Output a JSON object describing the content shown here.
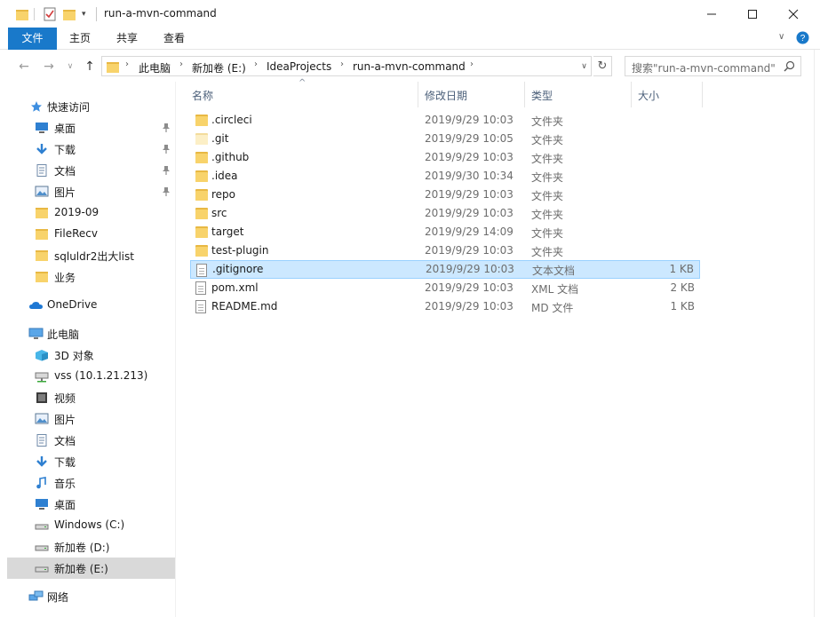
{
  "window": {
    "title": "run-a-mvn-command",
    "minimize_icon": "minimize-icon",
    "maximize_icon": "maximize-icon",
    "close_icon": "close-icon"
  },
  "ribbon": {
    "tabs": [
      "文件",
      "主页",
      "共享",
      "查看"
    ]
  },
  "address": {
    "breadcrumbs": [
      "此电脑",
      "新加卷 (E:)",
      "IdeaProjects",
      "run-a-mvn-command"
    ],
    "search_placeholder": "搜索\"run-a-mvn-command\""
  },
  "nav": {
    "quick_access": "快速访问",
    "quick_items": [
      {
        "label": "桌面",
        "icon": "desktop-icon",
        "pinned": true
      },
      {
        "label": "下载",
        "icon": "download-icon",
        "pinned": true
      },
      {
        "label": "文档",
        "icon": "document-icon",
        "pinned": true
      },
      {
        "label": "图片",
        "icon": "picture-icon",
        "pinned": true
      },
      {
        "label": "2019-09",
        "icon": "folder-icon",
        "pinned": false
      },
      {
        "label": "FileRecv",
        "icon": "folder-icon",
        "pinned": false
      },
      {
        "label": "sqluldr2出大list",
        "icon": "folder-icon",
        "pinned": false
      },
      {
        "label": "业务",
        "icon": "folder-icon",
        "pinned": false
      }
    ],
    "onedrive": "OneDrive",
    "this_pc": "此电脑",
    "pc_items": [
      {
        "label": "3D 对象",
        "icon": "3d-objects-icon"
      },
      {
        "label": "vss (10.1.21.213)",
        "icon": "network-drive-icon"
      },
      {
        "label": "视频",
        "icon": "video-icon"
      },
      {
        "label": "图片",
        "icon": "picture-icon"
      },
      {
        "label": "文档",
        "icon": "document-icon"
      },
      {
        "label": "下载",
        "icon": "download-icon"
      },
      {
        "label": "音乐",
        "icon": "music-icon"
      },
      {
        "label": "桌面",
        "icon": "desktop-icon"
      },
      {
        "label": "Windows  (C:)",
        "icon": "drive-icon"
      },
      {
        "label": "新加卷 (D:)",
        "icon": "drive-icon"
      },
      {
        "label": "新加卷 (E:)",
        "icon": "drive-icon"
      }
    ],
    "network": "网络"
  },
  "columns": {
    "name": "名称",
    "date": "修改日期",
    "type": "类型",
    "size": "大小"
  },
  "files": [
    {
      "name": ".circleci",
      "date": "2019/9/29 10:03",
      "type": "文件夹",
      "size": "",
      "kind": "folder"
    },
    {
      "name": ".git",
      "date": "2019/9/29 10:05",
      "type": "文件夹",
      "size": "",
      "kind": "hidden-folder"
    },
    {
      "name": ".github",
      "date": "2019/9/29 10:03",
      "type": "文件夹",
      "size": "",
      "kind": "folder"
    },
    {
      "name": ".idea",
      "date": "2019/9/30 10:34",
      "type": "文件夹",
      "size": "",
      "kind": "folder"
    },
    {
      "name": "repo",
      "date": "2019/9/29 10:03",
      "type": "文件夹",
      "size": "",
      "kind": "folder"
    },
    {
      "name": "src",
      "date": "2019/9/29 10:03",
      "type": "文件夹",
      "size": "",
      "kind": "folder"
    },
    {
      "name": "target",
      "date": "2019/9/29 14:09",
      "type": "文件夹",
      "size": "",
      "kind": "folder"
    },
    {
      "name": "test-plugin",
      "date": "2019/9/29 10:03",
      "type": "文件夹",
      "size": "",
      "kind": "folder"
    },
    {
      "name": ".gitignore",
      "date": "2019/9/29 10:03",
      "type": "文本文档",
      "size": "1 KB",
      "kind": "file"
    },
    {
      "name": "pom.xml",
      "date": "2019/9/29 10:03",
      "type": "XML 文档",
      "size": "2 KB",
      "kind": "file"
    },
    {
      "name": "README.md",
      "date": "2019/9/29 10:03",
      "type": "MD 文件",
      "size": "1 KB",
      "kind": "file"
    }
  ],
  "selected_file": ".gitignore",
  "selected_nav": "新加卷 (E:)",
  "colors": {
    "accent": "#1979ca",
    "selection": "#cce8ff",
    "folder": "#f8d36b"
  }
}
